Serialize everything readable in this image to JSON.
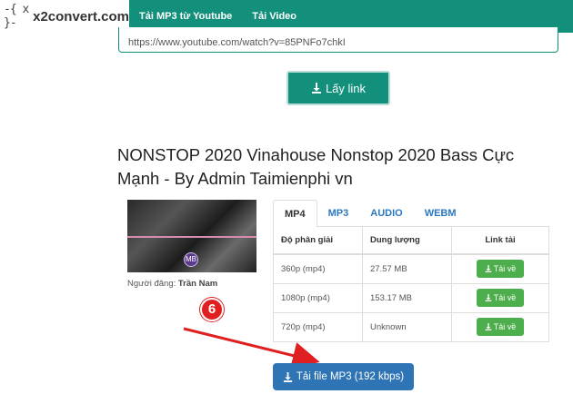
{
  "header": {
    "logo_mark": "-{ x }-",
    "logo_text": "x2convert.com",
    "nav": [
      "Tải MP3 từ Youtube",
      "Tải Video"
    ]
  },
  "search": {
    "url_value": "https://www.youtube.com/watch?v=85PNFo7chkI"
  },
  "get_link_label": "Lấy link",
  "video": {
    "title": "NONSTOP 2020 Vinahouse Nonstop 2020 Bass Cực Mạnh - By Admin Taimienphi vn",
    "uploader_label": "Người đăng:",
    "uploader_name": "Trần Nam",
    "thumb_badge": "MB"
  },
  "step_marker": "6",
  "tabs": [
    "MP4",
    "MP3",
    "AUDIO",
    "WEBM"
  ],
  "table": {
    "headers": [
      "Độ phân giải",
      "Dung lượng",
      "Link tải"
    ],
    "rows": [
      {
        "resolution": "360p (mp4)",
        "size": "27.57 MB",
        "action": "Tải về"
      },
      {
        "resolution": "1080p (mp4)",
        "size": "153.17 MB",
        "action": "Tải về"
      },
      {
        "resolution": "720p (mp4)",
        "size": "Unknown",
        "action": "Tải về"
      }
    ]
  },
  "mp3_button_label": "Tải file MP3 (192 kbps)",
  "colors": {
    "brand": "#12907c",
    "download_green": "#4cae4c",
    "mp3_blue": "#2f74b5",
    "marker_red": "#e02020",
    "link_blue": "#2a78c0"
  }
}
